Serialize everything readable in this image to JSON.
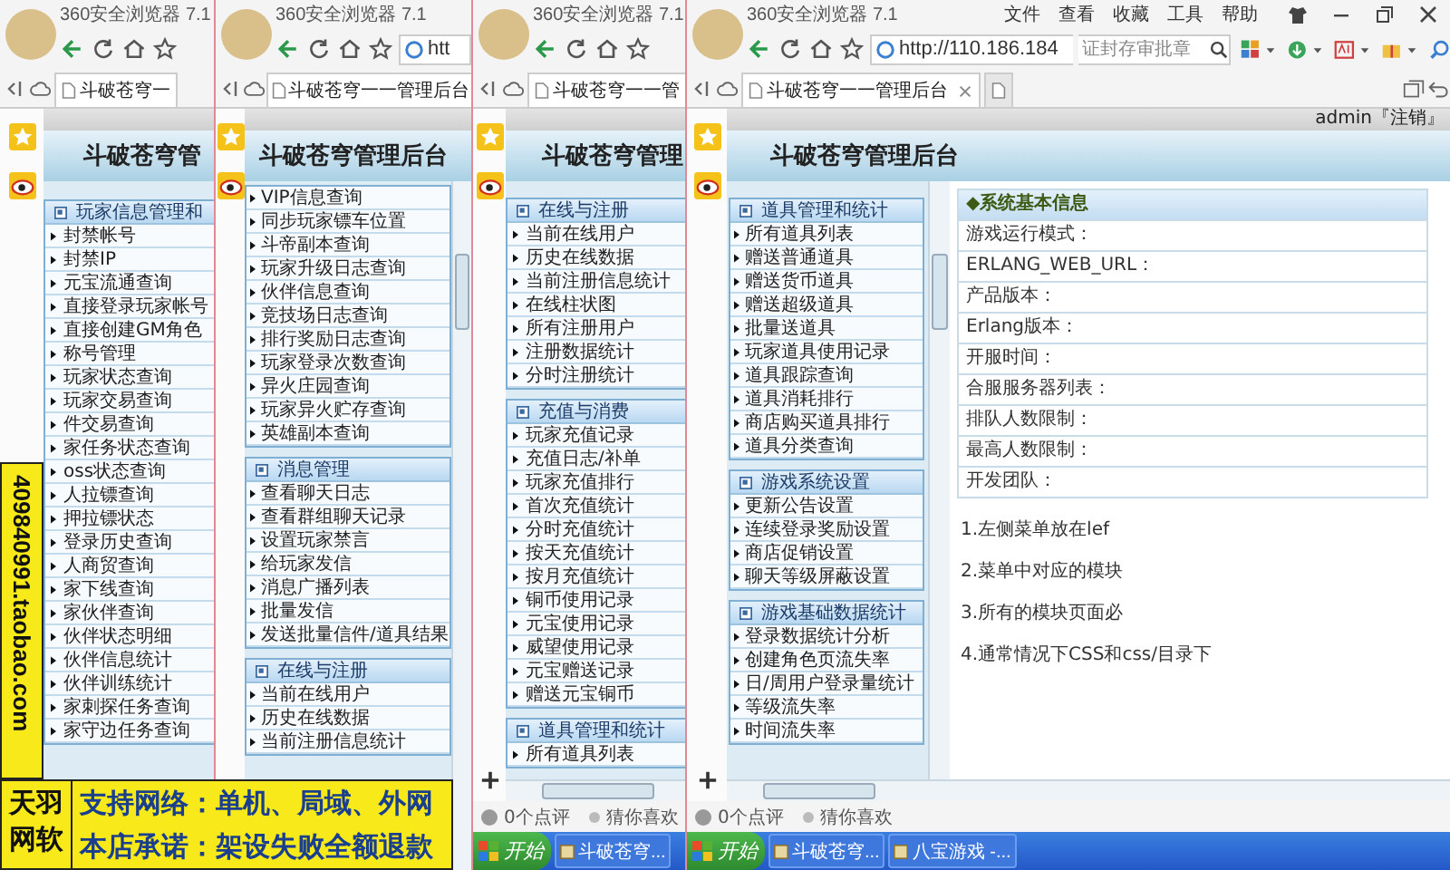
{
  "windows": [
    {
      "app_title": "360安全浏览器 7.1",
      "tabs": [
        {
          "label": "斗破苍穹一",
          "selected": true
        }
      ],
      "page_title": "斗破苍穹管",
      "menu": [
        {
          "title": "玩家信息管理和",
          "items": [
            "封禁帐号",
            "封禁IP",
            "元宝流通查询",
            "直接登录玩家帐号",
            "直接创建GM角色",
            "称号管理",
            "玩家状态查询",
            "玩家交易查询",
            "件交易查询",
            "家任务状态查询",
            "oss状态查询",
            "人拉镖查询",
            "押拉镖状态",
            "登录历史查询",
            "人商贸查询",
            "家下线查询",
            "家伙伴查询",
            "伙伴状态明细",
            "伙伴信息统计",
            "伙伴训练统计",
            "家刺探任务查询",
            "家守边任务查询"
          ]
        }
      ]
    },
    {
      "app_title": "360安全浏览器 7.1",
      "address": "htt",
      "tabs": [
        {
          "label": "斗破苍穹一一管理后台",
          "selected": true
        }
      ],
      "page_title": "斗破苍穹管理后台",
      "menu": [
        {
          "items": [
            "VIP信息查询",
            "同步玩家镖车位置",
            "斗帝副本查询",
            "玩家升级日志查询",
            "伙伴信息查询",
            "竞技场日志查询",
            "排行奖励日志查询",
            "玩家登录次数查询",
            "异火庄园查询",
            "玩家异火贮存查询",
            "英雄副本查询"
          ]
        },
        {
          "title": "消息管理",
          "items": [
            "查看聊天日志",
            "查看群组聊天记录",
            "设置玩家禁言",
            "给玩家发信",
            "消息广播列表",
            "批量发信",
            "发送批量信件/道具结果"
          ]
        },
        {
          "title": "在线与注册",
          "items": [
            "当前在线用户",
            "历史在线数据",
            "当前注册信息统计"
          ]
        }
      ]
    },
    {
      "app_title": "360安全浏览器 7.1",
      "tabs": [
        {
          "label": "斗破苍穹一一管",
          "selected": true
        }
      ],
      "page_title": "斗破苍穹管理",
      "menu": [
        {
          "title": "在线与注册",
          "items": [
            "当前在线用户",
            "历史在线数据",
            "当前注册信息统计",
            "在线柱状图",
            "所有注册用户",
            "注册数据统计",
            "分时注册统计"
          ]
        },
        {
          "title": "充值与消费",
          "items": [
            "玩家充值记录",
            "充值日志/补单",
            "玩家充值排行",
            "首次充值统计",
            "分时充值统计",
            "按天充值统计",
            "按月充值统计",
            "铜币使用记录",
            "元宝使用记录",
            "威望使用记录",
            "元宝赠送记录",
            "赠送元宝铜币"
          ]
        },
        {
          "title": "道具管理和统计",
          "items": [
            "所有道具列表"
          ]
        }
      ],
      "status": {
        "reviews": "0个点评",
        "recommend": "猜你喜欢"
      },
      "taskbar": {
        "start": "开始",
        "tasks": [
          "斗破苍穹..."
        ]
      }
    },
    {
      "app_title": "360安全浏览器 7.1",
      "menu_bar": [
        "文件",
        "查看",
        "收藏",
        "工具",
        "帮助"
      ],
      "address": "http://110.186.184",
      "search_hint": "证封存审批章",
      "tabs": [
        {
          "label": "斗破苍穹一一管理后台",
          "selected": true
        },
        {
          "selected": false
        }
      ],
      "user_link": "admin『注销』",
      "page_title": "斗破苍穹管理后台",
      "menu": [
        {
          "title": "道具管理和统计",
          "items": [
            "所有道具列表",
            "赠送普通道具",
            "赠送货币道具",
            "赠送超级道具",
            "批量送道具",
            "玩家道具使用记录",
            "道具跟踪查询",
            "道具消耗排行",
            "商店购买道具排行",
            "道具分类查询"
          ]
        },
        {
          "title": "游戏系统设置",
          "items": [
            "更新公告设置",
            "连续登录奖励设置",
            "商店促销设置",
            "聊天等级屏蔽设置"
          ]
        },
        {
          "title": "游戏基础数据统计",
          "items": [
            "登录数据统计分析",
            "创建角色页流失率",
            "日/周用户登录量统计",
            "等级流失率",
            "时间流失率"
          ]
        }
      ],
      "info_panel": {
        "title": "◆系统基本信息",
        "rows": [
          "游戏运行模式：",
          "ERLANG_WEB_URL：",
          "产品版本：",
          "Erlang版本：",
          "开服时间：",
          "合服服务器列表：",
          "排队人数限制：",
          "最高人数限制：",
          "开发团队："
        ]
      },
      "notes": [
        "1.左侧菜单放在lef",
        "2.菜单中对应的模块",
        "3.所有的模块页面必",
        "4.通常情况下CSS和css/目录下"
      ],
      "status": {
        "reviews": "0个点评",
        "recommend": "猜你喜欢"
      },
      "taskbar": {
        "start": "开始",
        "tasks": [
          "斗破苍穹...",
          "八宝游戏 -..."
        ]
      }
    }
  ],
  "ad_banner": {
    "vertical_text": "409840991.taobao.com",
    "brand": "天羽网软",
    "lines": [
      "支持网络：单机、局域、外网",
      "本店承诺：架设失败全额退款"
    ]
  }
}
